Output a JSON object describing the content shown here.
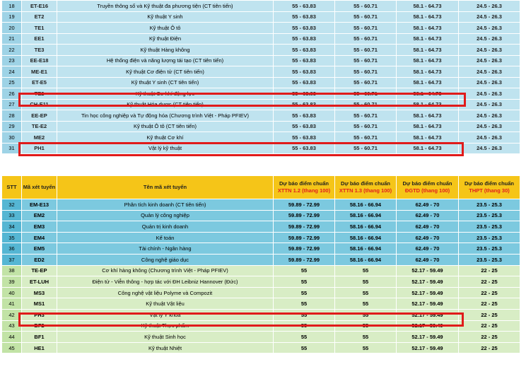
{
  "table1": {
    "rows": [
      {
        "stt": "18",
        "code": "ET-E16",
        "name": "Truyền thông số và Kỹ thuật đa phương tiện (CT tiên tiến)",
        "a": "55 - 63.83",
        "b": "55 - 60.71",
        "c": "58.1 - 64.73",
        "d": "24.5 - 26.3"
      },
      {
        "stt": "19",
        "code": "ET2",
        "name": "Kỹ thuật Y sinh",
        "a": "55 - 63.83",
        "b": "55 - 60.71",
        "c": "58.1 - 64.73",
        "d": "24.5 - 26.3"
      },
      {
        "stt": "20",
        "code": "TE1",
        "name": "Kỹ thuật Ô tô",
        "a": "55 - 63.83",
        "b": "55 - 60.71",
        "c": "58.1 - 64.73",
        "d": "24.5 - 26.3"
      },
      {
        "stt": "21",
        "code": "EE1",
        "name": "Kỹ thuật Điện",
        "a": "55 - 63.83",
        "b": "55 - 60.71",
        "c": "58.1 - 64.73",
        "d": "24.5 - 26.3"
      },
      {
        "stt": "22",
        "code": "TE3",
        "name": "Kỹ thuật Hàng không",
        "a": "55 - 63.83",
        "b": "55 - 60.71",
        "c": "58.1 - 64.73",
        "d": "24.5 - 26.3"
      },
      {
        "stt": "23",
        "code": "EE-E18",
        "name": "Hệ thống điện và năng lượng tái tạo (CT tiên tiến)",
        "a": "55 - 63.83",
        "b": "55 - 60.71",
        "c": "58.1 - 64.73",
        "d": "24.5 - 26.3"
      },
      {
        "stt": "24",
        "code": "ME-E1",
        "name": "Kỹ thuật Cơ điện tử (CT tiên tiến)",
        "a": "55 - 63.83",
        "b": "55 - 60.71",
        "c": "58.1 - 64.73",
        "d": "24.5 - 26.3"
      },
      {
        "stt": "25",
        "code": "ET-E5",
        "name": "Kỹ thuật Y sinh (CT tiên tiến)",
        "a": "55 - 63.83",
        "b": "55 - 60.71",
        "c": "58.1 - 64.73",
        "d": "24.5 - 26.3"
      },
      {
        "stt": "26",
        "code": "TE2",
        "name": "Kỹ thuật Cơ khí động lực",
        "a": "55 - 63.83",
        "b": "55 - 60.71",
        "c": "58.1 - 64.73",
        "d": "24.5 - 26.3"
      },
      {
        "stt": "27",
        "code": "CH-E11",
        "name": "Kỹ thuật Hóa dược (CT tiên tiến)",
        "a": "55 - 63.83",
        "b": "55 - 60.71",
        "c": "58.1 - 64.73",
        "d": "24.5 - 26.3"
      },
      {
        "stt": "28",
        "code": "EE-EP",
        "name": "Tin học công nghiệp và Tự động hóa (Chương trình Việt - Pháp PFIEV)",
        "a": "55 - 63.83",
        "b": "55 - 60.71",
        "c": "58.1 - 64.73",
        "d": "24.5 - 26.3"
      },
      {
        "stt": "29",
        "code": "TE-E2",
        "name": "Kỹ thuật Ô tô (CT tiên tiến)",
        "a": "55 - 63.83",
        "b": "55 - 60.71",
        "c": "58.1 - 64.73",
        "d": "24.5 - 26.3"
      },
      {
        "stt": "30",
        "code": "ME2",
        "name": "Kỹ thuật Cơ khí",
        "a": "55 - 63.83",
        "b": "55 - 60.71",
        "c": "58.1 - 64.73",
        "d": "24.5 - 26.3"
      },
      {
        "stt": "31",
        "code": "PH1",
        "name": "Vật lý kỹ thuật",
        "a": "55 - 63.83",
        "b": "55 - 60.71",
        "c": "58.1 - 64.73",
        "d": "24.5 - 26.3"
      }
    ]
  },
  "table2": {
    "headers": {
      "stt": "STT",
      "code": "Mã xét tuyển",
      "name": "Tên mã xét tuyển",
      "a_top": "Dự báo điểm chuẩn",
      "a_bot": "XTTN 1.2 (thang 100)",
      "b_top": "Dự báo điểm chuẩn",
      "b_bot": "XTTN 1.3 (thang 100)",
      "c_top": "Dự báo điểm chuẩn",
      "c_bot": "ĐGTD (thang 100)",
      "d_top": "Dự báo điểm chuẩn",
      "d_bot": "THPT (thang 30)"
    },
    "rows": [
      {
        "stt": "32",
        "code": "EM-E13",
        "name": "Phân tích kinh doanh (CT tiên tiến)",
        "a": "59.89 - 72.99",
        "b": "58.16 - 66.94",
        "c": "62.49 - 70",
        "d": "23.5 - 25.3",
        "group": "blue"
      },
      {
        "stt": "33",
        "code": "EM2",
        "name": "Quản lý công nghiệp",
        "a": "59.89 - 72.99",
        "b": "58.16 - 66.94",
        "c": "62.49 - 70",
        "d": "23.5 - 25.3",
        "group": "blue"
      },
      {
        "stt": "34",
        "code": "EM3",
        "name": "Quản trị kinh doanh",
        "a": "59.89 - 72.99",
        "b": "58.16 - 66.94",
        "c": "62.49 - 70",
        "d": "23.5 - 25.3",
        "group": "blue"
      },
      {
        "stt": "35",
        "code": "EM4",
        "name": "Kế toán",
        "a": "59.89 - 72.99",
        "b": "58.16 - 66.94",
        "c": "62.49 - 70",
        "d": "23.5 - 25.3",
        "group": "blue"
      },
      {
        "stt": "36",
        "code": "EM5",
        "name": "Tài chính - Ngân hàng",
        "a": "59.89 - 72.99",
        "b": "58.16 - 66.94",
        "c": "62.49 - 70",
        "d": "23.5 - 25.3",
        "group": "blue"
      },
      {
        "stt": "37",
        "code": "ED2",
        "name": "Công nghệ giáo dục",
        "a": "59.89 - 72.99",
        "b": "58.16 - 66.94",
        "c": "62.49 - 70",
        "d": "23.5 - 25.3",
        "group": "blue"
      },
      {
        "stt": "38",
        "code": "TE-EP",
        "name": "Cơ khí hàng không (Chương trình Việt - Pháp PFIEV)",
        "a": "55",
        "b": "55",
        "c": "52.17 - 59.49",
        "d": "22 - 25",
        "group": "green"
      },
      {
        "stt": "39",
        "code": "ET-LUH",
        "name": "Điện tử - Viễn thông - hợp tác với ĐH Leibniz Hannover (Đức)",
        "a": "55",
        "b": "55",
        "c": "52.17 - 59.49",
        "d": "22 - 25",
        "group": "green"
      },
      {
        "stt": "40",
        "code": "MS3",
        "name": "Công nghệ vật liệu Polyme và Compozit",
        "a": "55",
        "b": "55",
        "c": "52.17 - 59.49",
        "d": "22 - 25",
        "group": "green"
      },
      {
        "stt": "41",
        "code": "MS1",
        "name": "Kỹ thuật Vật liệu",
        "a": "55",
        "b": "55",
        "c": "52.17 - 59.49",
        "d": "22 - 25",
        "group": "green"
      },
      {
        "stt": "42",
        "code": "PH3",
        "name": "Vật lý Y khoa",
        "a": "55",
        "b": "55",
        "c": "52.17 - 59.49",
        "d": "22 - 25",
        "group": "green"
      },
      {
        "stt": "43",
        "code": "BF2",
        "name": "Kỹ thuật Thực phẩm",
        "a": "55",
        "b": "55",
        "c": "52.17 - 59.49",
        "d": "22 - 25",
        "group": "green"
      },
      {
        "stt": "44",
        "code": "BF1",
        "name": "Kỹ thuật Sinh học",
        "a": "55",
        "b": "55",
        "c": "52.17 - 59.49",
        "d": "22 - 25",
        "group": "green"
      },
      {
        "stt": "45",
        "code": "HE1",
        "name": "Kỹ thuật Nhiệt",
        "a": "55",
        "b": "55",
        "c": "52.17 - 59.49",
        "d": "22 - 25",
        "group": "green"
      }
    ]
  },
  "highlight_color": "#e01b1b"
}
